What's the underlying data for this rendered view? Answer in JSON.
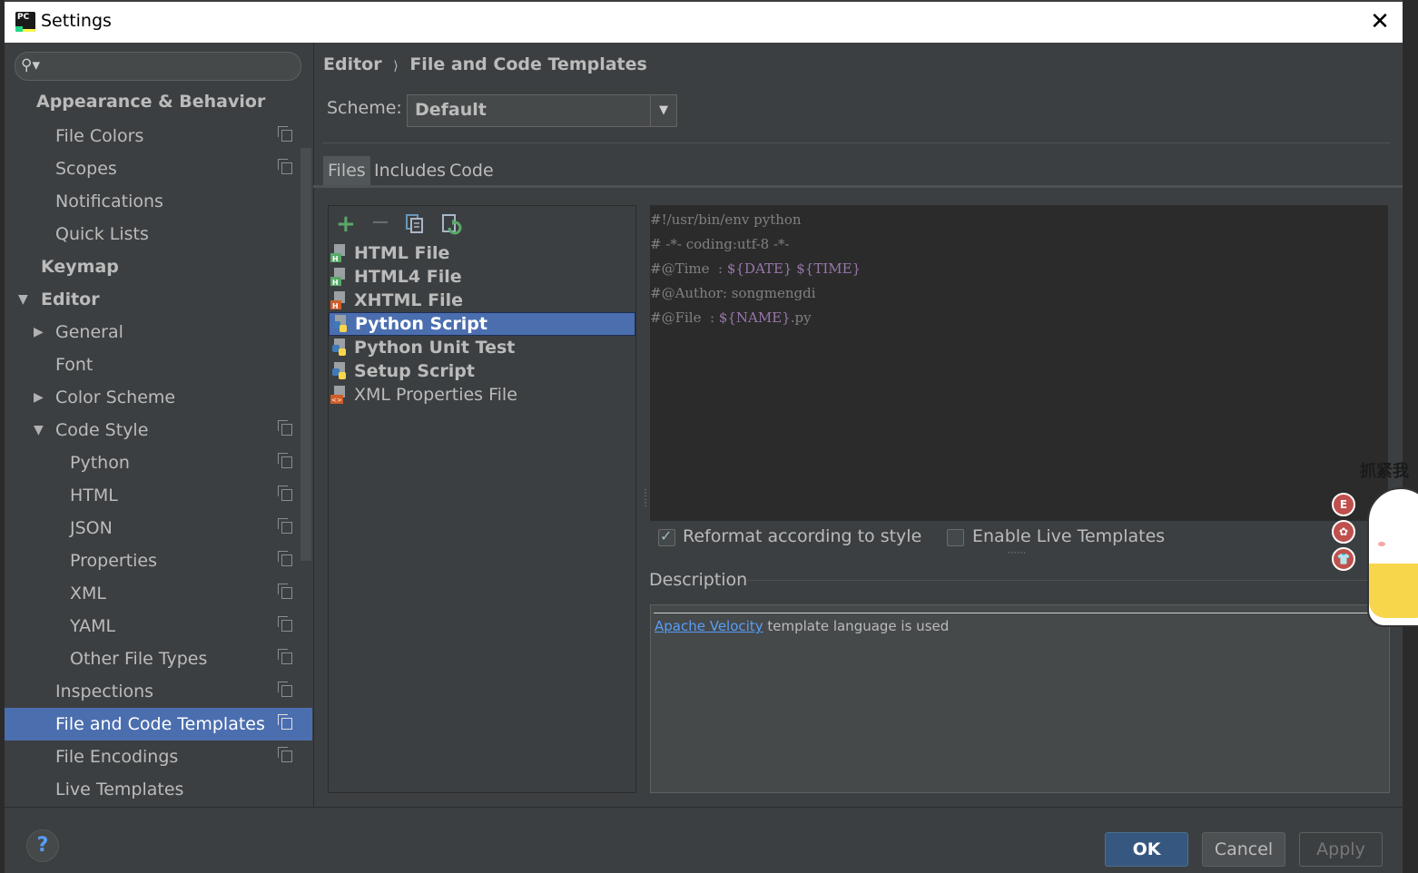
{
  "window": {
    "title": "Settings",
    "close_icon": "close-icon"
  },
  "search": {
    "placeholder": ""
  },
  "sidebar": {
    "items": [
      {
        "label": "Appearance & Behavior"
      },
      {
        "label": "File Colors"
      },
      {
        "label": "Scopes"
      },
      {
        "label": "Notifications"
      },
      {
        "label": "Quick Lists"
      },
      {
        "label": "Keymap"
      },
      {
        "label": "Editor"
      },
      {
        "label": "General"
      },
      {
        "label": "Font"
      },
      {
        "label": "Color Scheme"
      },
      {
        "label": "Code Style"
      },
      {
        "label": "Python"
      },
      {
        "label": "HTML"
      },
      {
        "label": "JSON"
      },
      {
        "label": "Properties"
      },
      {
        "label": "XML"
      },
      {
        "label": "YAML"
      },
      {
        "label": "Other File Types"
      },
      {
        "label": "Inspections"
      },
      {
        "label": "File and Code Templates"
      },
      {
        "label": "File Encodings"
      },
      {
        "label": "Live Templates"
      }
    ]
  },
  "breadcrumb": {
    "parent": "Editor",
    "separator": "⟩",
    "current": "File and Code Templates"
  },
  "scheme": {
    "label": "Scheme:",
    "value": "Default"
  },
  "tabs": [
    {
      "label": "Files"
    },
    {
      "label": "Includes"
    },
    {
      "label": "Code"
    }
  ],
  "templates": [
    {
      "label": "HTML File"
    },
    {
      "label": "HTML4 File"
    },
    {
      "label": "XHTML File"
    },
    {
      "label": "Python Script"
    },
    {
      "label": "Python Unit Test"
    },
    {
      "label": "Setup Script"
    },
    {
      "label": "XML Properties File"
    }
  ],
  "editor": {
    "lines": [
      {
        "a": "#!/usr/bin/env python",
        "v1": "",
        "m": "",
        "v2": "",
        "z": ""
      },
      {
        "a": "# -*- coding:utf-8 -*-",
        "v1": "",
        "m": "",
        "v2": "",
        "z": ""
      },
      {
        "a": "#@Time  : ",
        "v1": "${DATE}",
        "m": " ",
        "v2": "${TIME}",
        "z": ""
      },
      {
        "a": "#@Author: songmengdi",
        "v1": "",
        "m": "",
        "v2": "",
        "z": ""
      },
      {
        "a": "#@File  : ",
        "v1": "${NAME}",
        "m": "",
        "v2": "",
        "z": ".py"
      }
    ]
  },
  "options": {
    "reformat_label": "Reformat according to style",
    "reformat_checked": true,
    "live_templates_label": "Enable Live Templates",
    "live_templates_checked": false
  },
  "description": {
    "label": "Description",
    "link": "Apache Velocity",
    "text": " template language is used"
  },
  "buttons": {
    "ok": "OK",
    "cancel": "Cancel",
    "apply": "Apply",
    "help": "?"
  },
  "sticker": {
    "text": "抓紧我",
    "btn1": "E",
    "btn2": "✿",
    "btn3": "👕"
  },
  "colors": {
    "accent": "#4b6eaf",
    "background": "#3c3f41",
    "editor_bg": "#2b2b2b",
    "link": "#589df6"
  }
}
